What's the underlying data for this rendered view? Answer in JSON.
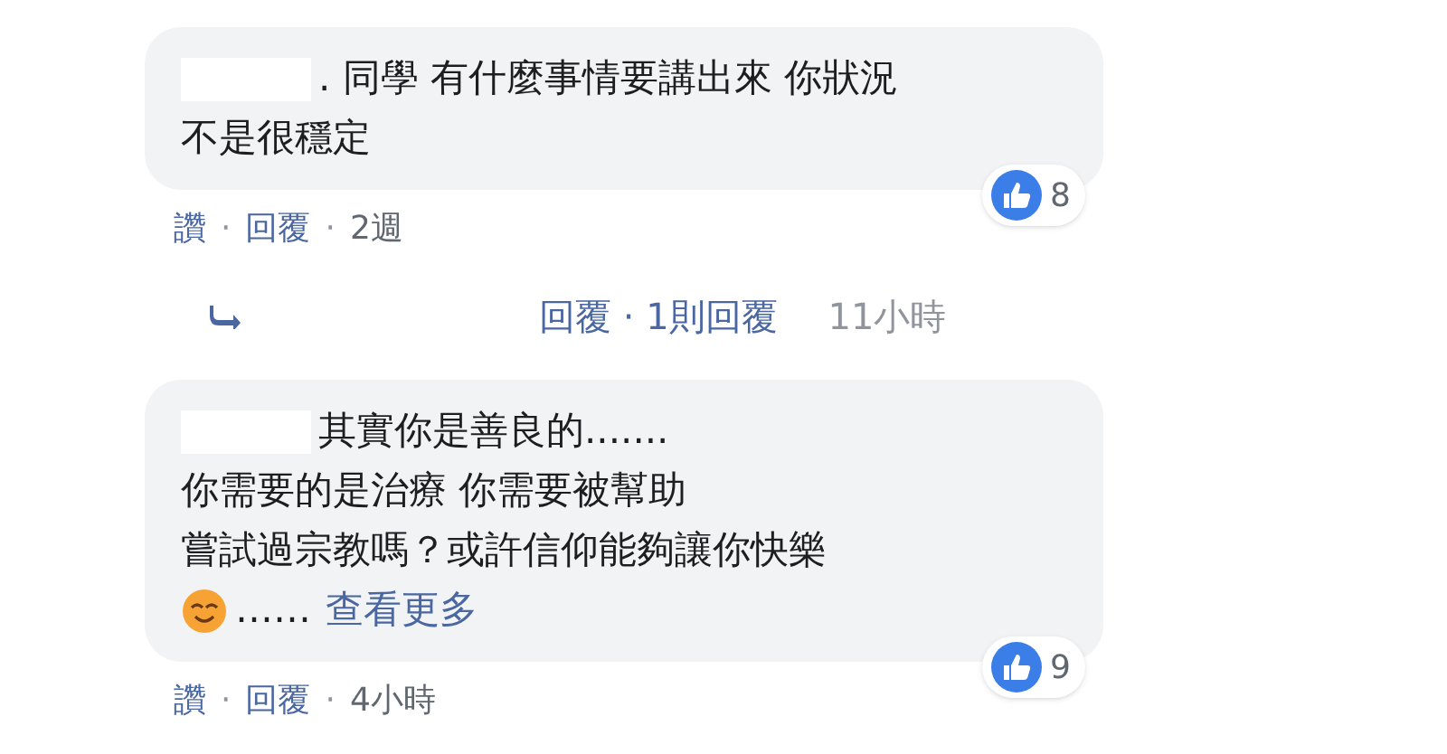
{
  "comments": [
    {
      "kind": "comment",
      "redacted_name": true,
      "lines": [
        ". 同學 有什麼事情要講出來 你狀況",
        "不是很穩定"
      ],
      "emoji": false,
      "likes": "8",
      "actions": [
        {
          "kind": "link",
          "text": "讚"
        },
        {
          "kind": "separator",
          "text": "·"
        },
        {
          "kind": "link",
          "text": "回覆"
        },
        {
          "kind": "separator",
          "text": "·"
        }
      ],
      "time": "2週"
    },
    {
      "kind": "replies",
      "text": "回覆 · 1則回覆",
      "time": "11小時"
    },
    {
      "kind": "comment",
      "redacted_name": true,
      "lines": [
        "其實你是善良的.......",
        "你需要的是治療 你需要被幫助",
        "嘗試過宗教嗎？或許信仰能夠讓你快樂"
      ],
      "emoji": true,
      "see_more_prefix": "……",
      "see_more": "查看更多",
      "likes": "9",
      "actions": [
        {
          "kind": "link",
          "text": "讚"
        },
        {
          "kind": "separator",
          "text": "·"
        },
        {
          "kind": "link",
          "text": "回覆"
        },
        {
          "kind": "separator",
          "text": "·"
        }
      ],
      "time": "4小時"
    }
  ]
}
